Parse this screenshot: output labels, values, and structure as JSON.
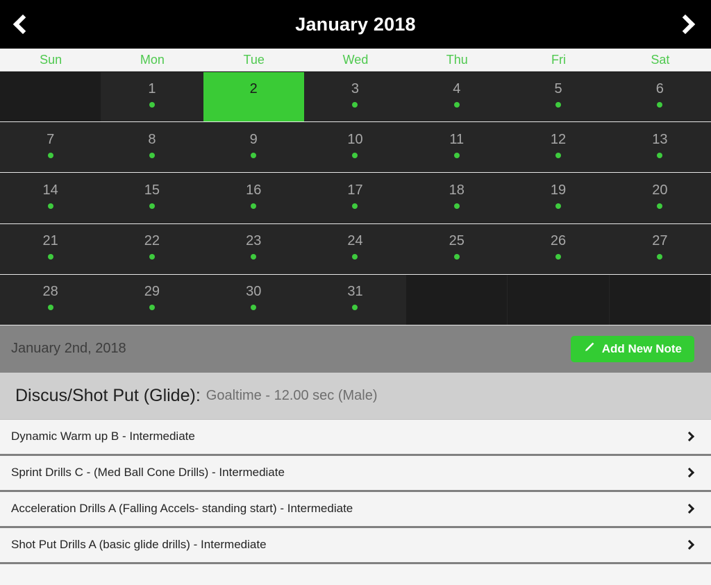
{
  "header": {
    "title": "January 2018",
    "prev_icon": "chevron-left-icon",
    "next_icon": "chevron-right-icon"
  },
  "weekdays": [
    "Sun",
    "Mon",
    "Tue",
    "Wed",
    "Thu",
    "Fri",
    "Sat"
  ],
  "calendar": {
    "weeks": [
      [
        {
          "day": "",
          "dot": false,
          "selected": false,
          "empty": true
        },
        {
          "day": "1",
          "dot": true,
          "selected": false,
          "empty": false
        },
        {
          "day": "2",
          "dot": false,
          "selected": true,
          "empty": false
        },
        {
          "day": "3",
          "dot": true,
          "selected": false,
          "empty": false
        },
        {
          "day": "4",
          "dot": true,
          "selected": false,
          "empty": false
        },
        {
          "day": "5",
          "dot": true,
          "selected": false,
          "empty": false
        },
        {
          "day": "6",
          "dot": true,
          "selected": false,
          "empty": false
        }
      ],
      [
        {
          "day": "7",
          "dot": true,
          "selected": false,
          "empty": false
        },
        {
          "day": "8",
          "dot": true,
          "selected": false,
          "empty": false
        },
        {
          "day": "9",
          "dot": true,
          "selected": false,
          "empty": false
        },
        {
          "day": "10",
          "dot": true,
          "selected": false,
          "empty": false
        },
        {
          "day": "11",
          "dot": true,
          "selected": false,
          "empty": false
        },
        {
          "day": "12",
          "dot": true,
          "selected": false,
          "empty": false
        },
        {
          "day": "13",
          "dot": true,
          "selected": false,
          "empty": false
        }
      ],
      [
        {
          "day": "14",
          "dot": true,
          "selected": false,
          "empty": false
        },
        {
          "day": "15",
          "dot": true,
          "selected": false,
          "empty": false
        },
        {
          "day": "16",
          "dot": true,
          "selected": false,
          "empty": false
        },
        {
          "day": "17",
          "dot": true,
          "selected": false,
          "empty": false
        },
        {
          "day": "18",
          "dot": true,
          "selected": false,
          "empty": false
        },
        {
          "day": "19",
          "dot": true,
          "selected": false,
          "empty": false
        },
        {
          "day": "20",
          "dot": true,
          "selected": false,
          "empty": false
        }
      ],
      [
        {
          "day": "21",
          "dot": true,
          "selected": false,
          "empty": false
        },
        {
          "day": "22",
          "dot": true,
          "selected": false,
          "empty": false
        },
        {
          "day": "23",
          "dot": true,
          "selected": false,
          "empty": false
        },
        {
          "day": "24",
          "dot": true,
          "selected": false,
          "empty": false
        },
        {
          "day": "25",
          "dot": true,
          "selected": false,
          "empty": false
        },
        {
          "day": "26",
          "dot": true,
          "selected": false,
          "empty": false
        },
        {
          "day": "27",
          "dot": true,
          "selected": false,
          "empty": false
        }
      ],
      [
        {
          "day": "28",
          "dot": true,
          "selected": false,
          "empty": false
        },
        {
          "day": "29",
          "dot": true,
          "selected": false,
          "empty": false
        },
        {
          "day": "30",
          "dot": true,
          "selected": false,
          "empty": false
        },
        {
          "day": "31",
          "dot": true,
          "selected": false,
          "empty": false
        },
        {
          "day": "",
          "dot": false,
          "selected": false,
          "empty": true
        },
        {
          "day": "",
          "dot": false,
          "selected": false,
          "empty": true
        },
        {
          "day": "",
          "dot": false,
          "selected": false,
          "empty": true
        }
      ]
    ]
  },
  "date_bar": {
    "selected_date": "January 2nd, 2018",
    "add_note_label": "Add New Note",
    "add_note_icon": "pencil-icon"
  },
  "info": {
    "title": "Discus/Shot Put (Glide):",
    "subtitle": "Goaltime - 12.00 sec (Male)"
  },
  "drills": [
    {
      "label": "Dynamic Warm up B - Intermediate",
      "chevron": "chevron-right-icon"
    },
    {
      "label": "Sprint Drills C - (Med Ball Cone Drills) - Intermediate",
      "chevron": "chevron-right-icon"
    },
    {
      "label": "Acceleration Drills A (Falling Accels- standing start) - Intermediate",
      "chevron": "chevron-right-icon"
    },
    {
      "label": "Shot Put Drills A (basic glide drills) - Intermediate",
      "chevron": "chevron-right-icon"
    }
  ],
  "colors": {
    "accent_green": "#33cc33",
    "selected_day_green": "#3acb36",
    "weekday_green": "#4fc94f",
    "header_black": "#000000",
    "cell_dark": "#262626",
    "date_bar_gray": "#838383",
    "info_band_gray": "#cfcfcf",
    "row_light": "#f4f4f4"
  }
}
